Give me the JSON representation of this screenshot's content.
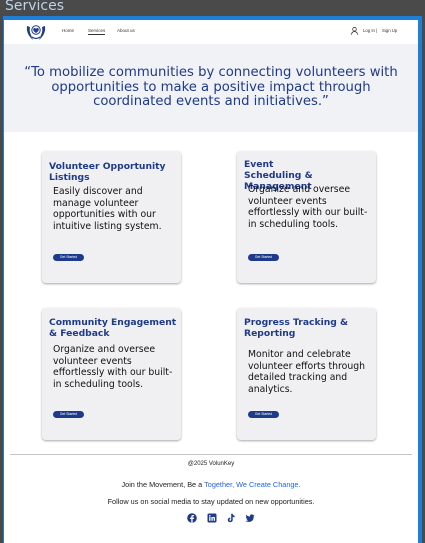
{
  "window": {
    "tab_title": "Services"
  },
  "header": {
    "nav": [
      "Home",
      "Services",
      "About us"
    ],
    "login": "Log In",
    "separator": "|",
    "signup": "Sign Up"
  },
  "hero": {
    "quote": "“To mobilize communities by connecting volunteers with opportunities to make a positive impact through coordinated events and initiatives.”"
  },
  "cards": [
    {
      "title": "Volunteer Opportunity Listings",
      "description": "Easily discover and manage volunteer opportunities with our intuitive listing system.",
      "button": "Get Started"
    },
    {
      "title": "Event Scheduling & Management",
      "description": "Organize and oversee volunteer events effortlessly with our built-in scheduling tools.",
      "button": "Get Started"
    },
    {
      "title": "Community Engagement & Feedback",
      "description": "Organize and oversee volunteer events effortlessly with our built-in scheduling tools.",
      "button": "Get Started"
    },
    {
      "title": "Progress Tracking & Reporting",
      "description": "Monitor and celebrate volunteer efforts through detailed tracking and analytics.",
      "button": "Get Started"
    }
  ],
  "footer": {
    "copyright": "@2025 VolunKey",
    "join_prefix": "Join the Movement, Be a ",
    "join_link": "Together, We Create Change.",
    "follow": "Follow us on social media to stay updated on new opportunities."
  },
  "social_icons": [
    "facebook-icon",
    "linkedin-icon",
    "tiktok-icon",
    "twitter-icon"
  ],
  "colors": {
    "primary": "#1e3a8a",
    "frame": "#1f7fd6",
    "link": "#2563eb",
    "band": "#f1f2f6"
  }
}
